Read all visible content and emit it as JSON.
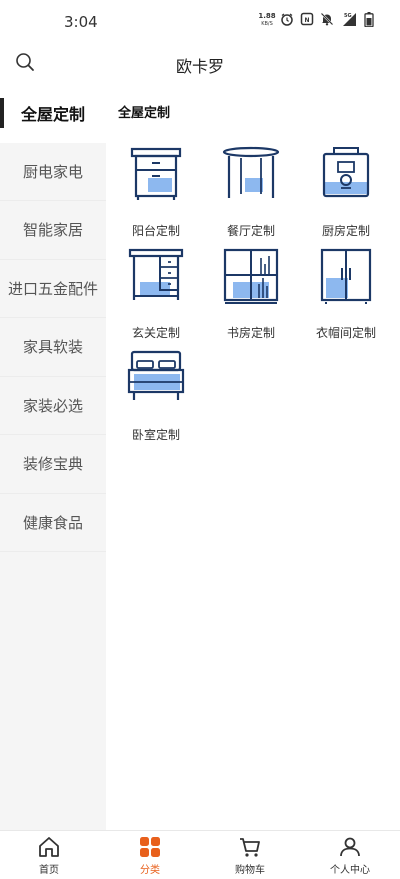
{
  "status_bar": {
    "time": "3:04",
    "net_speed": "1.88",
    "net_unit": "KB/S",
    "icons": [
      "alarm-icon",
      "nfc-icon",
      "mute-icon",
      "signal-5g-icon",
      "battery-icon"
    ]
  },
  "header": {
    "title": "欧卡罗",
    "search_icon": "search-icon"
  },
  "sidebar": {
    "items": [
      {
        "label": "全屋定制",
        "active": true
      },
      {
        "label": "厨电家电",
        "active": false
      },
      {
        "label": "智能家居",
        "active": false
      },
      {
        "label": "进口五金配件",
        "active": false
      },
      {
        "label": "家具软装",
        "active": false
      },
      {
        "label": "家装必选",
        "active": false
      },
      {
        "label": "装修宝典",
        "active": false
      },
      {
        "label": "健康食品",
        "active": false
      }
    ]
  },
  "content": {
    "section_title": "全屋定制",
    "categories": [
      {
        "label": "阳台定制",
        "icon": "cabinet-icon"
      },
      {
        "label": "餐厅定制",
        "icon": "dining-table-icon"
      },
      {
        "label": "厨房定制",
        "icon": "cooker-icon"
      },
      {
        "label": "玄关定制",
        "icon": "entrance-cabinet-icon"
      },
      {
        "label": "书房定制",
        "icon": "bookshelf-icon"
      },
      {
        "label": "衣帽间定制",
        "icon": "wardrobe-icon"
      },
      {
        "label": "卧室定制",
        "icon": "bed-icon"
      }
    ]
  },
  "bottom_nav": {
    "items": [
      {
        "label": "首页",
        "icon": "home-icon",
        "active": false
      },
      {
        "label": "分类",
        "icon": "category-icon",
        "active": true
      },
      {
        "label": "购物车",
        "icon": "cart-icon",
        "active": false
      },
      {
        "label": "个人中心",
        "icon": "user-icon",
        "active": false
      }
    ]
  },
  "colors": {
    "accent": "#e8601c",
    "icon_line": "#1c3866",
    "icon_fill": "#8db8ef",
    "sidebar_bg": "#f5f5f5"
  }
}
